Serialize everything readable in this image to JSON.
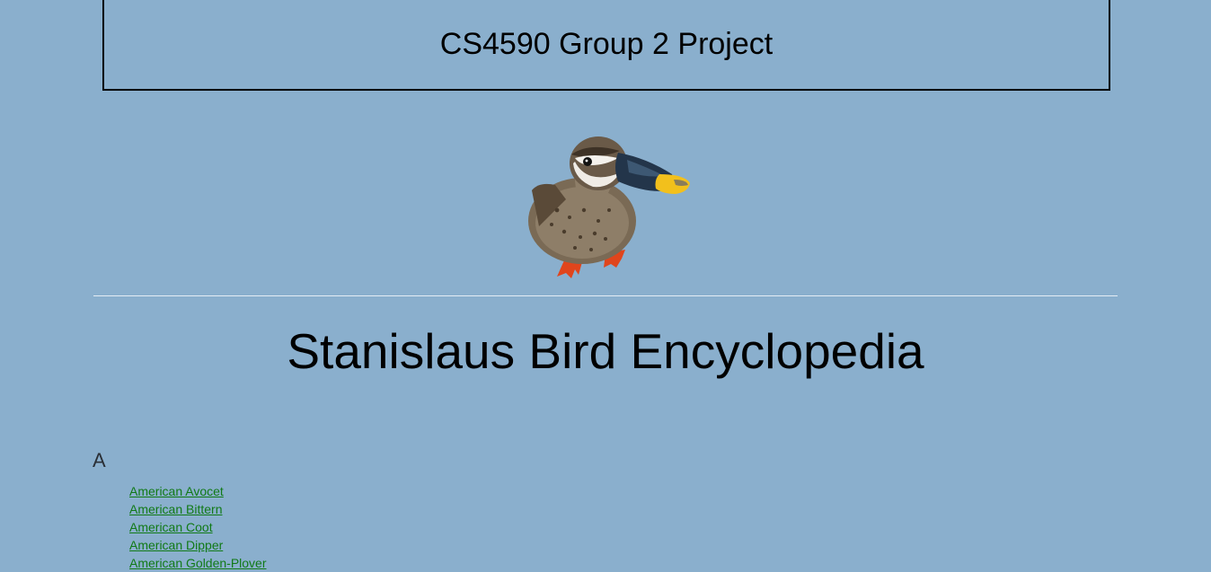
{
  "header": {
    "title": "CS4590 Group 2 Project"
  },
  "logo": {
    "icon": "duck-icon"
  },
  "main": {
    "title": "Stanislaus Bird Encyclopedia"
  },
  "index": {
    "sections": [
      {
        "letter": "A",
        "birds": [
          "American Avocet",
          "American Bittern",
          "American Coot",
          "American Dipper",
          "American Golden-Plover"
        ]
      }
    ]
  },
  "colors": {
    "background": "#8aafcd",
    "link": "#117a17"
  }
}
